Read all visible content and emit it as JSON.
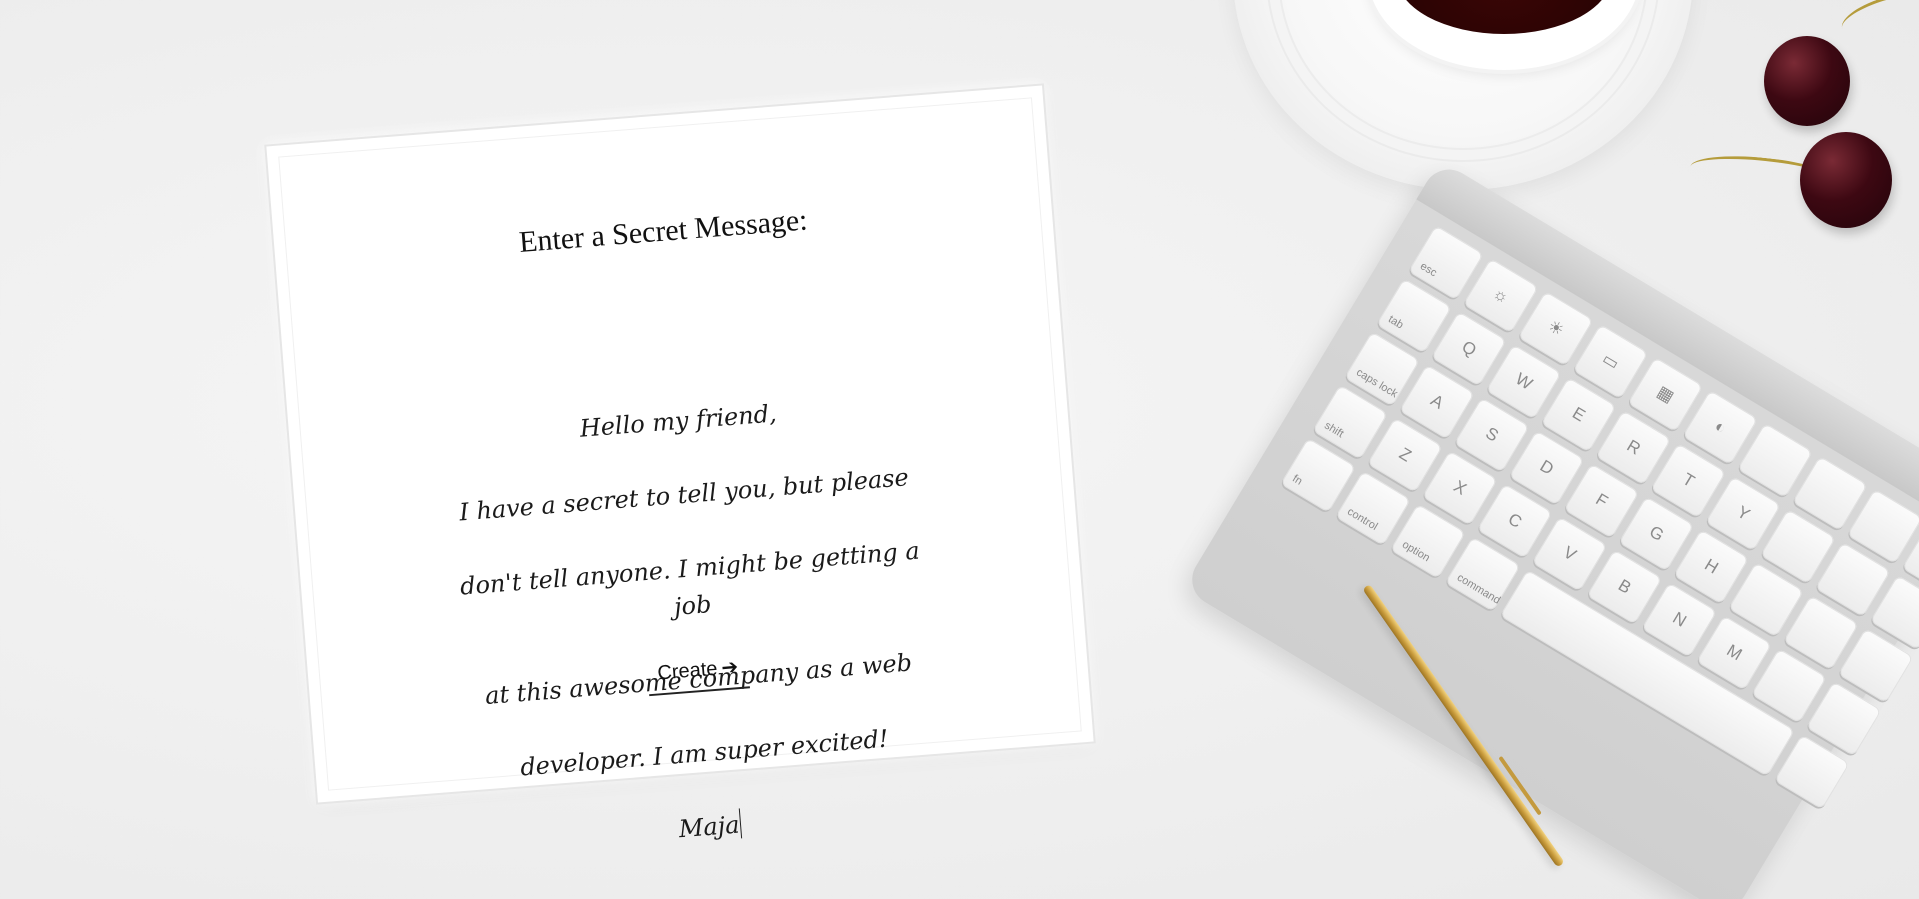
{
  "form": {
    "heading": "Enter a Secret Message:",
    "message_lines": [
      "Hello my friend,",
      "I have a secret to tell you, but please",
      "don't tell anyone. I might be getting a job",
      "at this awesome company as a web",
      "developer. I am super excited!",
      "Maja"
    ],
    "create_label": "Create",
    "create_icon": "arrow-right-icon"
  },
  "decor": {
    "background_color": "#efefef",
    "paper_color": "#ffffff",
    "coffee_color": "#2a0303",
    "cherry_color": "#3d0812",
    "pen_color": "#c89b3c",
    "keyboard_keys": [
      "esc",
      "tab",
      "caps lock",
      "shift",
      "fn",
      "control",
      "option",
      "command",
      "Q",
      "W",
      "E",
      "R",
      "T",
      "Y",
      "A",
      "S",
      "D",
      "F",
      "G",
      "H",
      "Z",
      "X",
      "C",
      "V",
      "B",
      "N",
      "M"
    ]
  }
}
